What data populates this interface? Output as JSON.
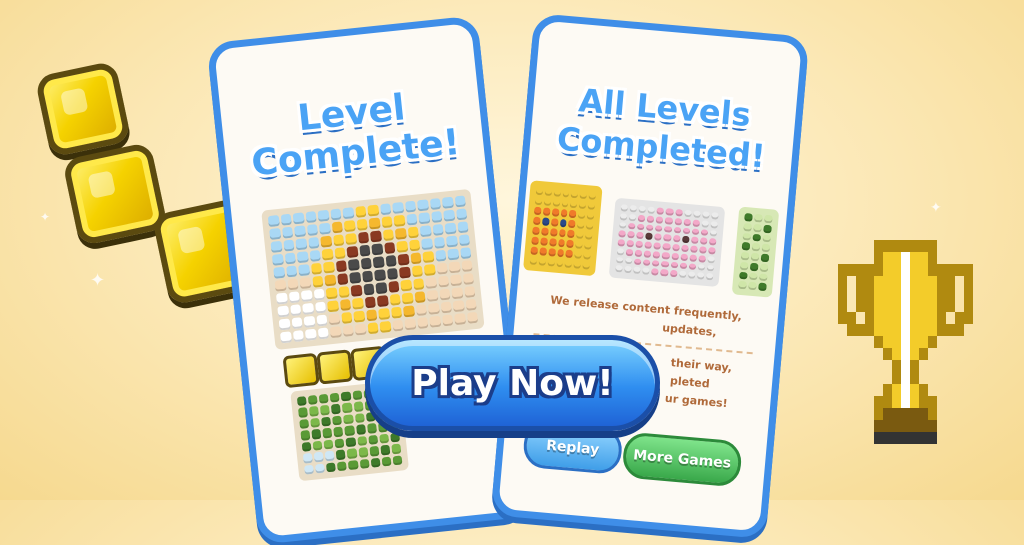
{
  "left_phone": {
    "title_line1": "Level",
    "title_line2": "Complete!"
  },
  "right_phone": {
    "title_line1": "All Levels",
    "title_line2": "Completed!",
    "message_line1": "We release content frequently,",
    "message_line2": "updates,",
    "message_line3": "their way,",
    "message_line4": "pleted",
    "message_line5": "ur games!",
    "replay_label": "Replay",
    "more_games_label": "More Games"
  },
  "cta": {
    "label": "Play Now!"
  },
  "colors": {
    "brand_blue": "#3f8ee8",
    "gem_yellow": "#f5d200",
    "replay_blue": "#5bb8f0",
    "more_games_green": "#48c057"
  },
  "icons": [
    "gold-gem-icon",
    "trophy-icon",
    "sparkle-icon"
  ]
}
